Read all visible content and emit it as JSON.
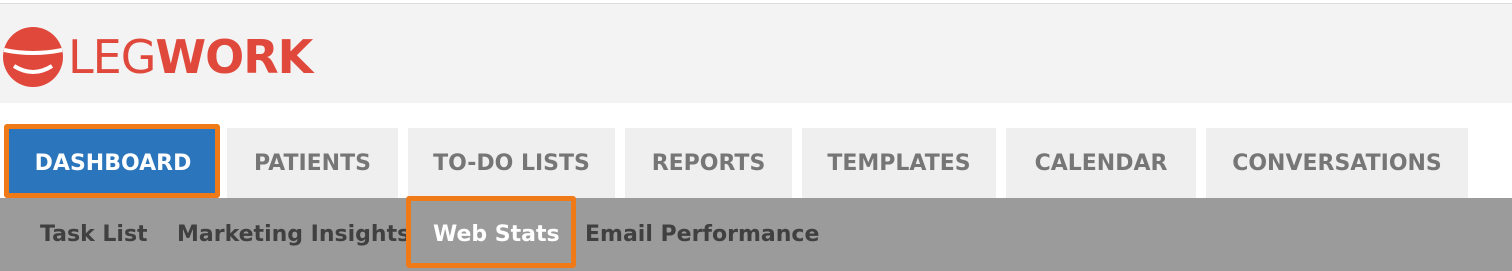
{
  "brand": {
    "logo_part1": "LEG",
    "logo_part2": "WORK",
    "color": "#e0483c"
  },
  "main_nav": {
    "tabs": [
      {
        "label": "DASHBOARD",
        "active": true
      },
      {
        "label": "PATIENTS",
        "active": false
      },
      {
        "label": "TO-DO LISTS",
        "active": false
      },
      {
        "label": "REPORTS",
        "active": false
      },
      {
        "label": "TEMPLATES",
        "active": false
      },
      {
        "label": "CALENDAR",
        "active": false
      },
      {
        "label": "CONVERSATIONS",
        "active": false
      }
    ],
    "active_color": "#2b75bc"
  },
  "sub_nav": {
    "items": [
      {
        "label": "Task List",
        "active": false
      },
      {
        "label": "Marketing Insights",
        "active": false
      },
      {
        "label": "Web Stats",
        "active": true
      },
      {
        "label": "Email Performance",
        "active": false
      }
    ]
  },
  "highlight_color": "#f07a18"
}
